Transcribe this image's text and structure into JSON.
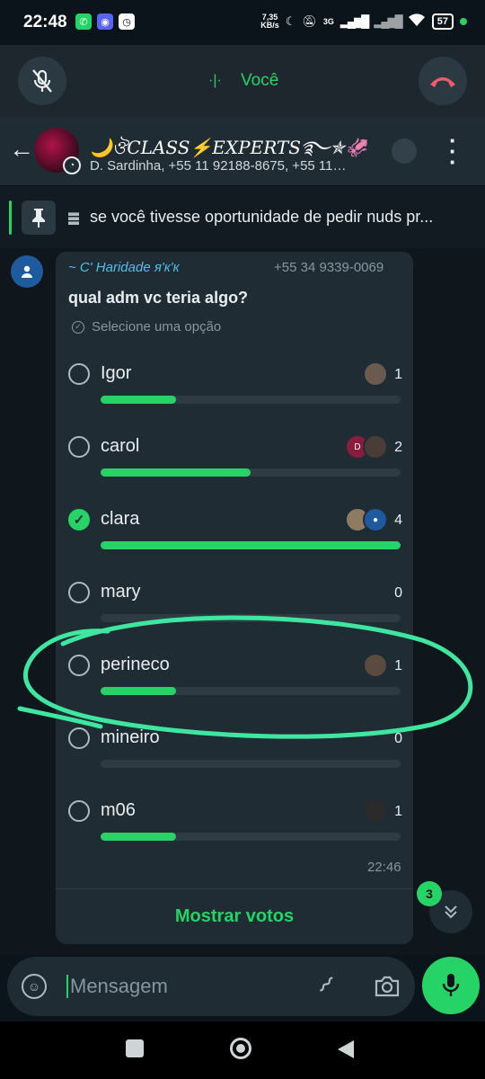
{
  "status_bar": {
    "time": "22:48",
    "net_speed_value": "7,35",
    "net_speed_unit": "KB/s",
    "network_type": "3G",
    "battery": "57"
  },
  "call_bar": {
    "label": "Você"
  },
  "header": {
    "group_name": "🌙ঔCLASS⚡EXPERTS࿐✯🦑",
    "subtitle": "D. Sardinha, +55 11 92188-8675, +55 11…"
  },
  "pinned": {
    "text": "se você tivesse oportunidade de pedir nuds pr..."
  },
  "poll": {
    "sender": "~ C' Haridade я'к'к",
    "phone": "+55 34 9339-0069",
    "question": "qual adm vc teria algo?",
    "select_hint": "Selecione uma opção",
    "time": "22:46",
    "show_votes": "Mostrar votos",
    "options": [
      {
        "label": "Igor",
        "votes": "1",
        "fraction": 0.25,
        "checked": false
      },
      {
        "label": "carol",
        "votes": "2",
        "fraction": 0.5,
        "checked": false
      },
      {
        "label": "clara",
        "votes": "4",
        "fraction": 1.0,
        "checked": true
      },
      {
        "label": "mary",
        "votes": "0",
        "fraction": 0.0,
        "checked": false
      },
      {
        "label": "perineco",
        "votes": "1",
        "fraction": 0.25,
        "checked": false
      },
      {
        "label": "mineiro",
        "votes": "0",
        "fraction": 0.0,
        "checked": false
      },
      {
        "label": "m06",
        "votes": "1",
        "fraction": 0.25,
        "checked": false
      }
    ]
  },
  "scroll": {
    "unread_count": "3"
  },
  "composer": {
    "placeholder": "Mensagem"
  },
  "colors": {
    "accent": "#25d366",
    "annotation_circle": "#3ee6a0",
    "end_call": "#f15c6d"
  }
}
